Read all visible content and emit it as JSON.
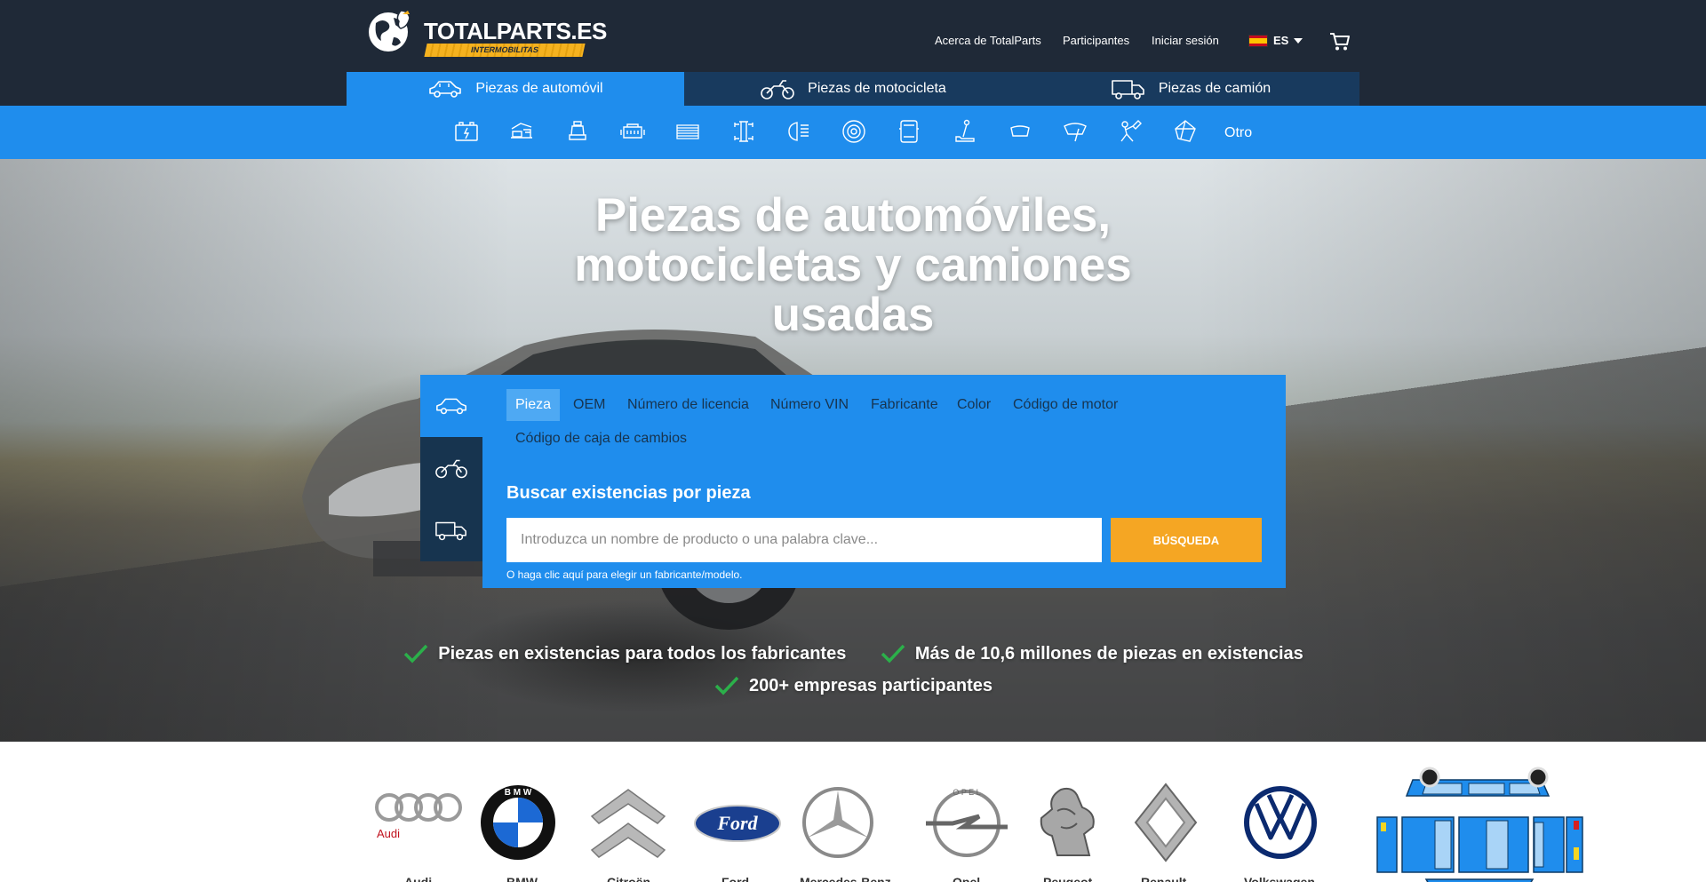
{
  "header": {
    "logo_text": "TOTALPARTS.ES",
    "logo_sub": "INTERMOBILITAS",
    "nav": [
      "Acerca de TotalParts",
      "Participantes",
      "Iniciar sesión"
    ],
    "language": "ES",
    "flag_colors": [
      "#c60b1e",
      "#ffc400"
    ]
  },
  "vehicle_tabs": [
    {
      "label": "Piezas de automóvil",
      "icon": "car-icon",
      "active": true
    },
    {
      "label": "Piezas de motocicleta",
      "icon": "motorcycle-icon",
      "active": false
    },
    {
      "label": "Piezas de camión",
      "icon": "truck-icon",
      "active": false
    }
  ],
  "categories": {
    "icons": [
      "battery-icon",
      "engine-compartment-icon",
      "seat-icon",
      "engine-icon",
      "radiator-icon",
      "chassis-icon",
      "headlight-icon",
      "brake-disc-icon",
      "door-icon",
      "gear-shift-icon",
      "mirror-icon",
      "wiper-icon",
      "repair-icon",
      "suspension-icon"
    ],
    "other_label": "Otro"
  },
  "hero": {
    "title": "Piezas de automóviles, motocicletas y camiones usadas"
  },
  "search": {
    "side_icons": [
      "car-icon",
      "motorcycle-icon",
      "truck-icon"
    ],
    "tabs": [
      "Pieza",
      "OEM",
      "Número de licencia",
      "Número VIN",
      "Fabricante",
      "Color",
      "Código de motor",
      "Código de caja de cambios"
    ],
    "active_tab": "Pieza",
    "heading": "Buscar existencias por pieza",
    "placeholder": "Introduzca un nombre de producto o una palabra clave...",
    "button": "BÚSQUEDA",
    "note": "O haga clic aquí para elegir un fabricante/modelo."
  },
  "benefits": [
    "Piezas en existencias para todos los fabricantes",
    "Más de 10,6 millones de piezas en existencias",
    "200+ empresas participantes"
  ],
  "brands": [
    {
      "name": "Audi",
      "logo": "audi-logo"
    },
    {
      "name": "BMW",
      "logo": "bmw-logo"
    },
    {
      "name": "Citroën",
      "logo": "citroen-logo"
    },
    {
      "name": "Ford",
      "logo": "ford-logo"
    },
    {
      "name": "Mercedes-Benz",
      "logo": "mercedes-logo"
    },
    {
      "name": "Opel",
      "logo": "opel-logo"
    },
    {
      "name": "Peugeot",
      "logo": "peugeot-logo"
    },
    {
      "name": "Renault",
      "logo": "renault-logo"
    },
    {
      "name": "Volkswagen",
      "logo": "volkswagen-logo"
    }
  ],
  "colors": {
    "header_bg": "#1f2937",
    "accent_blue": "#1f8ded",
    "dark_blue": "#17344f",
    "button_orange": "#f5a623",
    "check_green": "#2bb04a"
  }
}
